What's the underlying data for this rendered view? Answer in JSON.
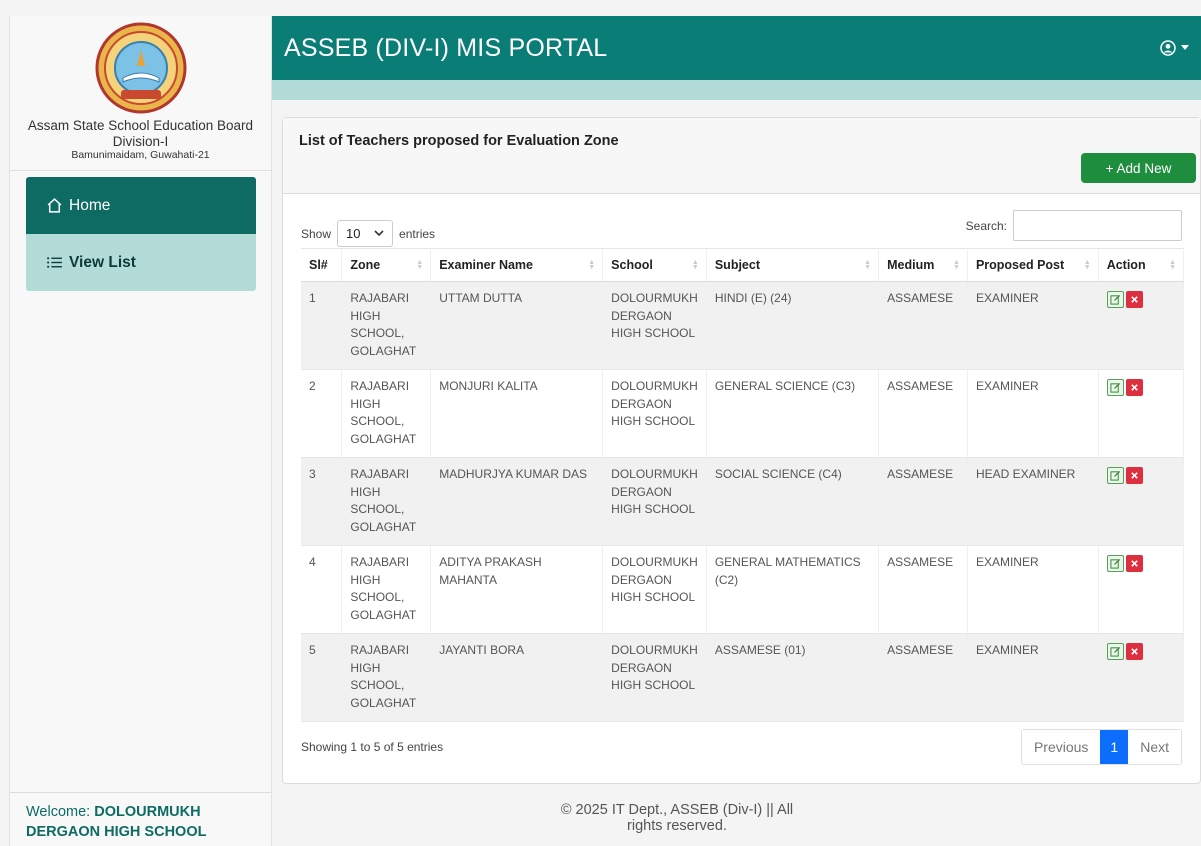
{
  "sidebar": {
    "board_name": "Assam State School Education Board",
    "division": "Division-I",
    "address": "Bamunimaidam, Guwahati-21",
    "menu": [
      {
        "label": "Home",
        "icon": "home-icon"
      },
      {
        "label": "View List",
        "icon": "list-icon"
      }
    ],
    "welcome_prefix": "Welcome:",
    "welcome_name": "DOLOURMUKH DERGAON HIGH SCHOOL"
  },
  "header": {
    "title": "ASSEB (DIV-I) MIS PORTAL",
    "user_icon": "user-circle-icon"
  },
  "card": {
    "title": "List of Teachers proposed for Evaluation Zone",
    "add_button": "+ Add New"
  },
  "table_controls": {
    "show_label": "Show",
    "entries_value": "10",
    "entries_label": "entries",
    "search_label": "Search:",
    "search_value": ""
  },
  "table": {
    "columns": [
      "Sl#",
      "Zone",
      "Examiner Name",
      "School",
      "Subject",
      "Medium",
      "Proposed Post",
      "Action"
    ],
    "rows": [
      {
        "sl": "1",
        "zone": "RAJABARI HIGH SCHOOL, GOLAGHAT",
        "name": "UTTAM DUTTA",
        "school": "DOLOURMUKH DERGAON HIGH SCHOOL",
        "subject": "HINDI (E) (24)",
        "medium": "ASSAMESE",
        "post": "EXAMINER"
      },
      {
        "sl": "2",
        "zone": "RAJABARI HIGH SCHOOL, GOLAGHAT",
        "name": "MONJURI KALITA",
        "school": "DOLOURMUKH DERGAON HIGH SCHOOL",
        "subject": "GENERAL SCIENCE (C3)",
        "medium": "ASSAMESE",
        "post": "EXAMINER"
      },
      {
        "sl": "3",
        "zone": "RAJABARI HIGH SCHOOL, GOLAGHAT",
        "name": "MADHURJYA KUMAR DAS",
        "school": "DOLOURMUKH DERGAON HIGH SCHOOL",
        "subject": "SOCIAL SCIENCE (C4)",
        "medium": "ASSAMESE",
        "post": "HEAD EXAMINER"
      },
      {
        "sl": "4",
        "zone": "RAJABARI HIGH SCHOOL, GOLAGHAT",
        "name": "ADITYA PRAKASH MAHANTA",
        "school": "DOLOURMUKH DERGAON HIGH SCHOOL",
        "subject": "GENERAL MATHEMATICS (C2)",
        "medium": "ASSAMESE",
        "post": "EXAMINER"
      },
      {
        "sl": "5",
        "zone": "RAJABARI HIGH SCHOOL, GOLAGHAT",
        "name": "JAYANTI BORA",
        "school": "DOLOURMUKH DERGAON HIGH SCHOOL",
        "subject": "ASSAMESE (01)",
        "medium": "ASSAMESE",
        "post": "EXAMINER"
      }
    ]
  },
  "pagination": {
    "info": "Showing 1 to 5 of 5 entries",
    "previous": "Previous",
    "current": "1",
    "next": "Next"
  },
  "footer": {
    "text": "© 2025 IT Dept., ASSEB (Div-I) || All rights reserved."
  },
  "colors": {
    "header": "#0b7d77",
    "menu_active": "#0e6b64",
    "menu_light": "#b3dcd9",
    "add_button": "#1e8e3e",
    "pager_active": "#0d6efd",
    "delete": "#dc2f3f"
  }
}
